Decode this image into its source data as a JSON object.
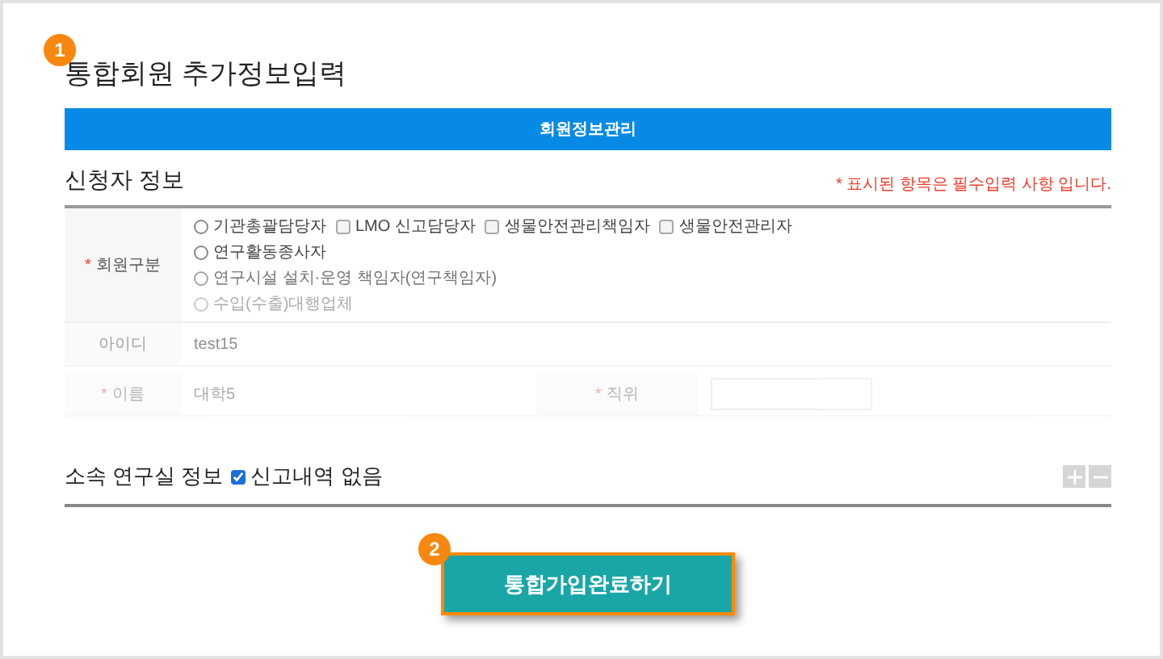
{
  "title_badge": "1",
  "title": "통합회원 추가정보입력",
  "tab_bar": {
    "label": "회원정보관리"
  },
  "applicant_section": {
    "heading": "신청자 정보",
    "required_note": "* 표시된 항목은 필수입력 사항 입니다.",
    "member_type": {
      "mark": "*",
      "label": "회원구분",
      "option_lines": [
        [
          {
            "kind": "radio",
            "label": "기관총괄담당자",
            "checked": false
          },
          {
            "kind": "checkbox",
            "label": "LMO 신고담당자",
            "checked": false
          },
          {
            "kind": "checkbox",
            "label": "생물안전관리책임자",
            "checked": false
          },
          {
            "kind": "checkbox",
            "label": "생물안전관리자",
            "checked": false
          }
        ],
        [
          {
            "kind": "radio",
            "label": "연구활동종사자",
            "checked": false
          }
        ],
        [
          {
            "kind": "radio",
            "label": "연구시설 설치·운영 책임자(연구책임자)",
            "checked": false
          }
        ],
        [
          {
            "kind": "radio",
            "label": "수입(수출)대행업체",
            "checked": false
          }
        ]
      ]
    },
    "id_row": {
      "label": "아이디",
      "value": "test15"
    },
    "name_row": {
      "mark": "*",
      "label": "이름",
      "value": "대학5",
      "position_mark": "*",
      "position_label": "직위"
    }
  },
  "lab_section": {
    "heading": "소속 연구실 정보",
    "no_report": {
      "label": "신고내역 없음",
      "checked": true
    }
  },
  "submit": {
    "badge": "2",
    "label": "통합가입완료하기"
  }
}
